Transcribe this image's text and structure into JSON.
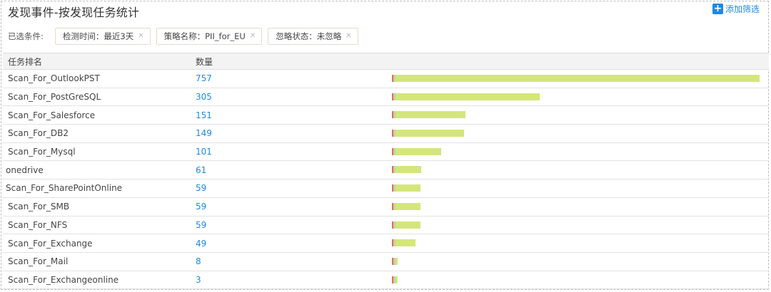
{
  "title": "发现事件-按发现任务统计",
  "add_filter_label": "添加筛选",
  "filters": {
    "label": "已选条件:",
    "chips": [
      {
        "text": "检测时间：最近3天"
      },
      {
        "text": "策略名称：PII_for_EU"
      },
      {
        "text": "忽略状态：未忽略"
      }
    ]
  },
  "table": {
    "headers": [
      "任务排名",
      "数量"
    ],
    "rows": [
      {
        "name": "Scan_For_OutlookPST",
        "count": "757"
      },
      {
        "name": "Scan_For_PostGreSQL",
        "count": "305"
      },
      {
        "name": "Scan_For_Salesforce",
        "count": "151"
      },
      {
        "name": "Scan_For_DB2",
        "count": "149"
      },
      {
        "name": "Scan_For_Mysql",
        "count": "101"
      },
      {
        "name": "onedrive",
        "count": "61"
      },
      {
        "name": "Scan_For_SharePointOnline",
        "count": "59"
      },
      {
        "name": "Scan_For_SMB",
        "count": "59"
      },
      {
        "name": "Scan_For_NFS",
        "count": "59"
      },
      {
        "name": "Scan_For_Exchange",
        "count": "49"
      },
      {
        "name": "Scan_For_Mail",
        "count": "8"
      },
      {
        "name": "Scan_For_Exchangeonline",
        "count": "3"
      }
    ],
    "max_count": 757
  },
  "colors": {
    "accent": "#1e88e5",
    "bar": "#d4e67a",
    "bar_start": "#e36b5a"
  }
}
